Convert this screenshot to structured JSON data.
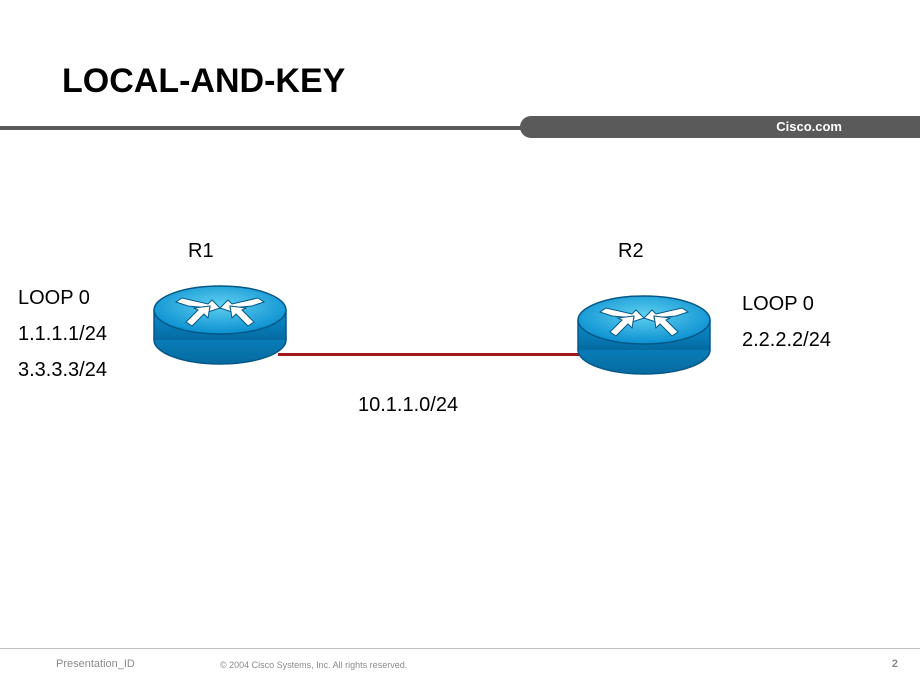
{
  "title": "LOCAL-AND-KEY",
  "brand": "Cisco.com",
  "diagram": {
    "r1": {
      "label": "R1"
    },
    "r2": {
      "label": "R2"
    },
    "left_loop": {
      "line1": "LOOP 0",
      "line2": "1.1.1.1/24",
      "line3": "3.3.3.3/24"
    },
    "right_loop": {
      "line1": "LOOP 0",
      "line2": "2.2.2.2/24"
    },
    "link": "10.1.1.0/24"
  },
  "footer": {
    "presentation_id": "Presentation_ID",
    "copyright": "© 2004 Cisco Systems, Inc. All rights reserved.",
    "page": "2"
  }
}
